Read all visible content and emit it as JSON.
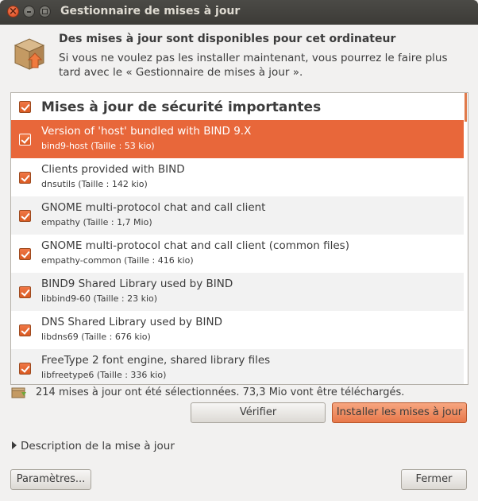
{
  "window": {
    "title": "Gestionnaire de mises à jour"
  },
  "header": {
    "title": "Des mises à jour sont disponibles pour cet ordinateur",
    "description": "Si vous ne voulez pas les installer maintenant, vous pourrez le faire plus tard avec le « Gestionnaire de mises à jour »."
  },
  "updates": {
    "category": "Mises à jour de sécurité importantes",
    "items": [
      {
        "name": "Version of 'host' bundled with BIND 9.X",
        "detail": "bind9-host (Taille : 53 kio)",
        "selected": true
      },
      {
        "name": "Clients provided with BIND",
        "detail": "dnsutils (Taille : 142 kio)"
      },
      {
        "name": "GNOME multi-protocol chat and call client",
        "detail": "empathy (Taille : 1,7 Mio)"
      },
      {
        "name": "GNOME multi-protocol chat and call client (common files)",
        "detail": "empathy-common (Taille : 416 kio)"
      },
      {
        "name": "BIND9 Shared Library used by BIND",
        "detail": "libbind9-60 (Taille : 23 kio)"
      },
      {
        "name": "DNS Shared Library used by BIND",
        "detail": "libdns69 (Taille : 676 kio)"
      },
      {
        "name": "FreeType 2 font engine, shared library files",
        "detail": "libfreetype6 (Taille : 336 kio)"
      }
    ]
  },
  "status": {
    "text": "214 mises à jour ont été sélectionnées. 73,3 Mio vont être téléchargés."
  },
  "buttons": {
    "check": "Vérifier",
    "install": "Installer les mises à jour",
    "settings": "Paramètres...",
    "close": "Fermer"
  },
  "expander": {
    "label": "Description de la mise à jour"
  },
  "colors": {
    "accent": "#e8673a",
    "titlebar": "#3c3b37"
  }
}
